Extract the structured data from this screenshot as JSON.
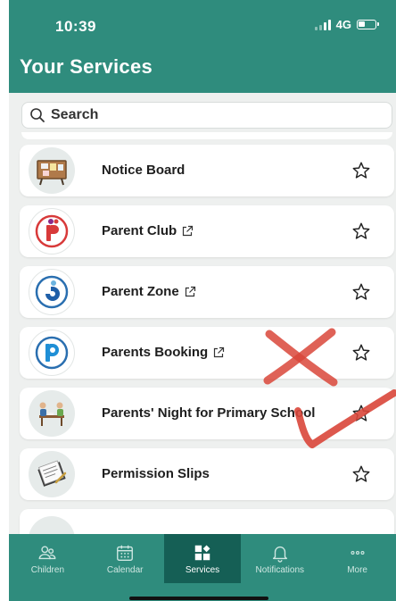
{
  "status_bar": {
    "time": "10:39",
    "network": "4G"
  },
  "header": {
    "title": "Your Services"
  },
  "search": {
    "placeholder": "Search",
    "value": ""
  },
  "services": [
    {
      "label": "Notice Board",
      "external_link": false,
      "icon": "notice-board-icon",
      "starred": false
    },
    {
      "label": "Parent Club",
      "external_link": true,
      "icon": "parent-club-logo-icon",
      "starred": false
    },
    {
      "label": "Parent Zone",
      "external_link": true,
      "icon": "parent-zone-logo-icon",
      "starred": false
    },
    {
      "label": "Parents Booking",
      "external_link": true,
      "icon": "parents-booking-logo-icon",
      "starred": false
    },
    {
      "label": "Parents' Night for Primary School",
      "external_link": false,
      "icon": "parents-night-icon",
      "starred": false
    },
    {
      "label": "Permission Slips",
      "external_link": false,
      "icon": "permission-slips-icon",
      "starred": false
    }
  ],
  "annotations": {
    "cross_color": "#d9463a",
    "tick_color": "#d9463a"
  },
  "tabs": [
    {
      "label": "Children",
      "icon": "children-icon",
      "active": false
    },
    {
      "label": "Calendar",
      "icon": "calendar-icon",
      "active": false
    },
    {
      "label": "Services",
      "icon": "services-icon",
      "active": true
    },
    {
      "label": "Notifications",
      "icon": "bell-icon",
      "active": false
    },
    {
      "label": "More",
      "icon": "more-icon",
      "active": false
    }
  ],
  "colors": {
    "brand_teal": "#2f8c7d",
    "active_tab": "#155f55"
  }
}
